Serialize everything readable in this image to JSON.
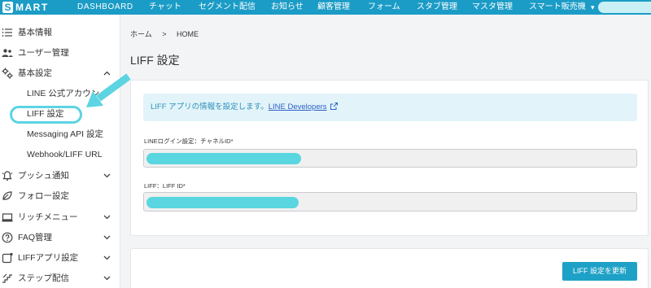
{
  "colors": {
    "brand": "#1b9cc6",
    "annotation": "#5cd4e2",
    "info_bg": "#e2f4fa",
    "link": "#2b5fc5",
    "button": "#1ea1c6"
  },
  "header": {
    "logo": {
      "initial": "S",
      "rest": "MART",
      "subtitle": "DASHBOARD"
    },
    "nav": [
      {
        "label": "チャット"
      },
      {
        "label": "セグメント配信"
      },
      {
        "label": "お知らせ"
      },
      {
        "label": "顧客管理"
      },
      {
        "label": "フォーム"
      },
      {
        "label": "スタブ管理"
      },
      {
        "label": "マスタ管理"
      },
      {
        "label": "スマート販売機",
        "dropdown": true
      }
    ],
    "dropdown_caret": "▾"
  },
  "sidebar": {
    "items": [
      {
        "label": "基本情報",
        "icon": "list-icon"
      },
      {
        "label": "ユーザー管理",
        "icon": "users-icon"
      },
      {
        "label": "基本設定",
        "icon": "gear-icon",
        "expanded": true,
        "children": [
          {
            "label": "LINE 公式アカウン"
          },
          {
            "label": "LIFF 設定",
            "active": true
          },
          {
            "label": "Messaging API 設定"
          },
          {
            "label": "Webhook/LIFF URL"
          }
        ]
      },
      {
        "label": "プッシュ通知",
        "icon": "bell-icon",
        "expandable": true
      },
      {
        "label": "フォロー設定",
        "icon": "follow-icon"
      },
      {
        "label": "リッチメニュー",
        "icon": "monitor-icon",
        "expandable": true
      },
      {
        "label": "FAQ管理",
        "icon": "question-icon",
        "expandable": true
      },
      {
        "label": "LIFFアプリ設定",
        "icon": "app-icon",
        "expandable": true
      },
      {
        "label": "ステップ配信",
        "icon": "steps-icon",
        "expandable": true
      }
    ]
  },
  "main": {
    "breadcrumb": {
      "home": "ホーム",
      "separator": ">",
      "current": "HOME"
    },
    "page_title": "LIFF 設定",
    "info": {
      "text": "LIFF アプリの情報を設定します。",
      "link_label": "LINE Developers",
      "link_icon": "external-link-icon"
    },
    "fields": [
      {
        "label": "LINEログイン設定：チャネルID*"
      },
      {
        "label": "LIFF：LIFF ID*"
      }
    ],
    "submit_label": "LIFF 設定を更新"
  }
}
